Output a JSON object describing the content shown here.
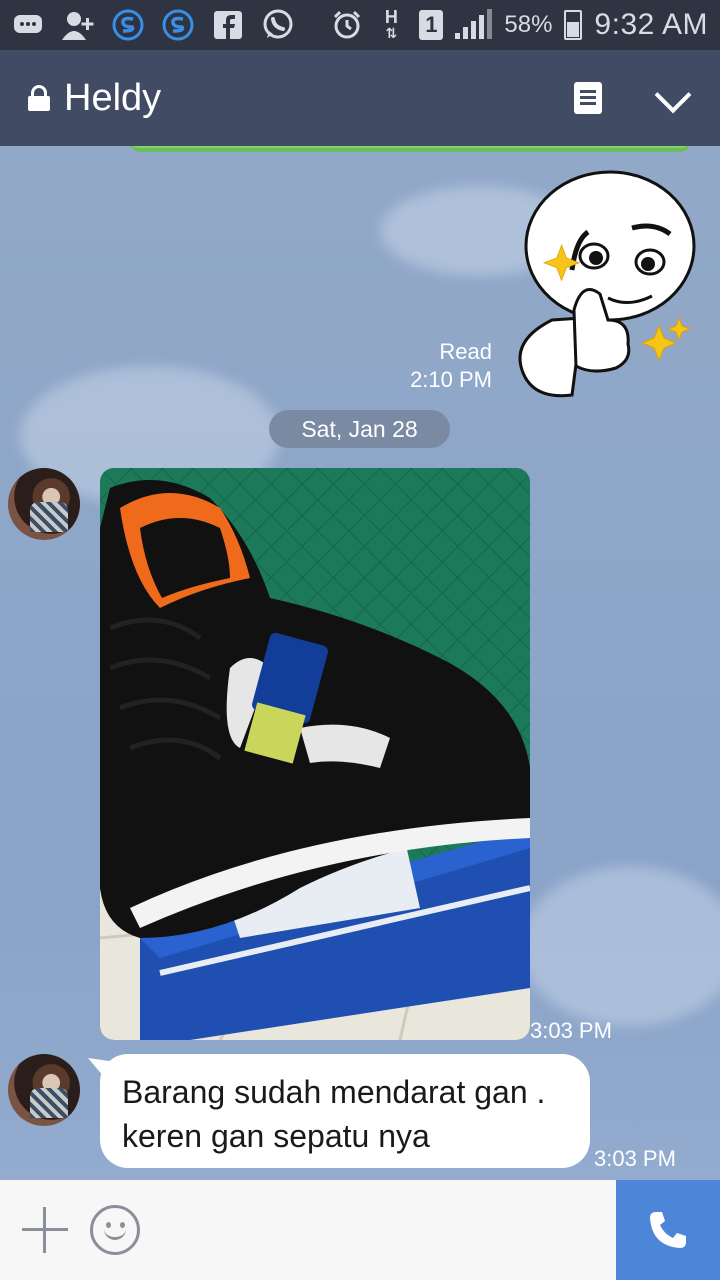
{
  "status_bar": {
    "icons": [
      "message-icon",
      "add-contact-icon",
      "s-app-icon",
      "s-app-icon",
      "facebook-icon",
      "whatsapp-icon",
      "alarm-icon",
      "h-data-icon",
      "sim-1-icon",
      "signal-icon",
      "battery-icon"
    ],
    "h_label": "H",
    "sim_label": "1",
    "battery_pct": "58%",
    "time": "9:32 AM"
  },
  "header": {
    "title": "Heldy"
  },
  "chat": {
    "sticker_read_label": "Read",
    "sticker_time": "2:10 PM",
    "date_separator": "Sat, Jan 28",
    "photo_time": "3:03 PM",
    "text_message": "Barang sudah mendarat gan . keren gan sepatu nya",
    "text_time": "3:03 PM"
  },
  "colors": {
    "status_bar": "#2e3442",
    "header": "#414b63",
    "call_button": "#4d86d9",
    "chat_background": "#8ea6c8"
  }
}
